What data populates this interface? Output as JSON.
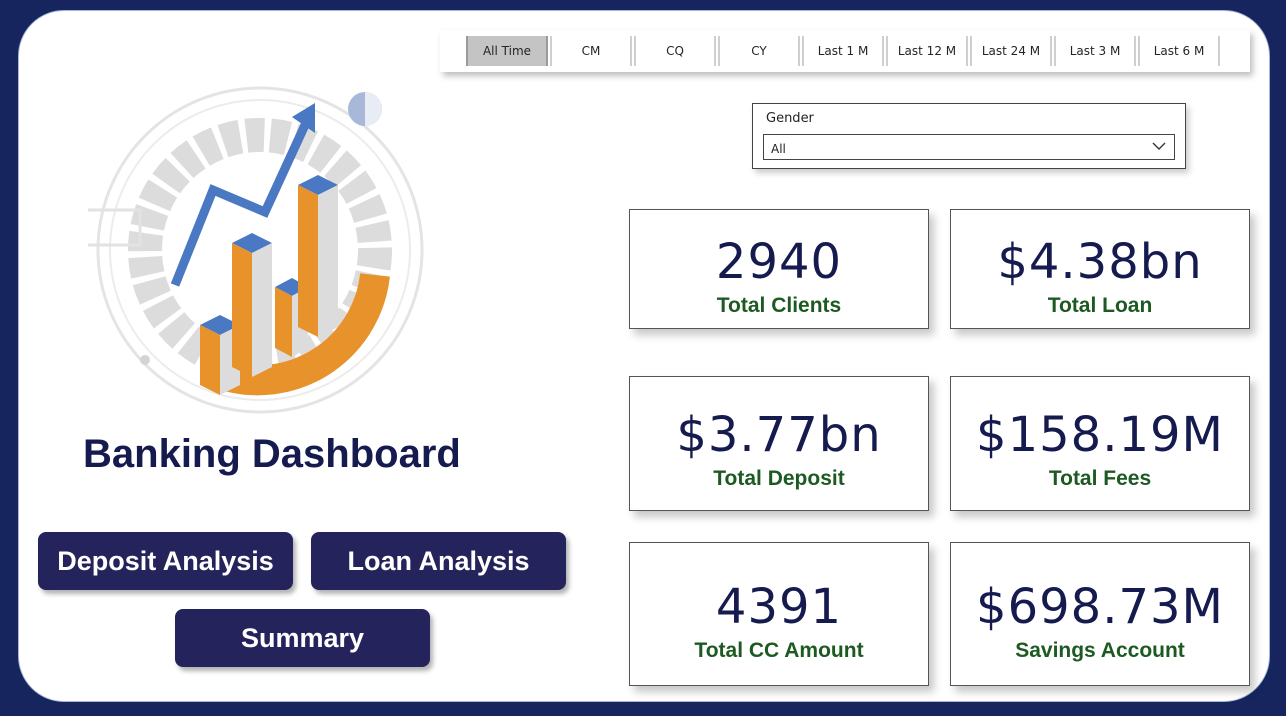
{
  "period_slicer": {
    "options": [
      "All Time",
      "CM",
      "CQ",
      "CY",
      "Last 1 M",
      "Last 12 M",
      "Last 24 M",
      "Last 3 M",
      "Last 6 M"
    ],
    "selected": "All Time"
  },
  "gender_slicer": {
    "title": "Gender",
    "value": "All"
  },
  "title": "Banking Dashboard",
  "buttons": {
    "deposit": "Deposit Analysis",
    "loan": "Loan Analysis",
    "summary": "Summary"
  },
  "kpis": [
    {
      "value": "2940",
      "label": "Total Clients"
    },
    {
      "value": "$4.38bn",
      "label": "Total Loan"
    },
    {
      "value": "$3.77bn",
      "label": "Total Deposit"
    },
    {
      "value": "$158.19M",
      "label": "Total Fees"
    },
    {
      "value": "4391",
      "label": "Total CC Amount"
    },
    {
      "value": "$698.73M",
      "label": "Savings Account"
    }
  ],
  "colors": {
    "background": "#16255e",
    "navy": "#151a4f",
    "button": "#25235c",
    "label_green": "#1d5a22",
    "orange": "#e8922c",
    "blue": "#4a78c2"
  },
  "icons": {
    "illustration": "growth-chart-illustration",
    "dropdown": "chevron-down-icon"
  }
}
